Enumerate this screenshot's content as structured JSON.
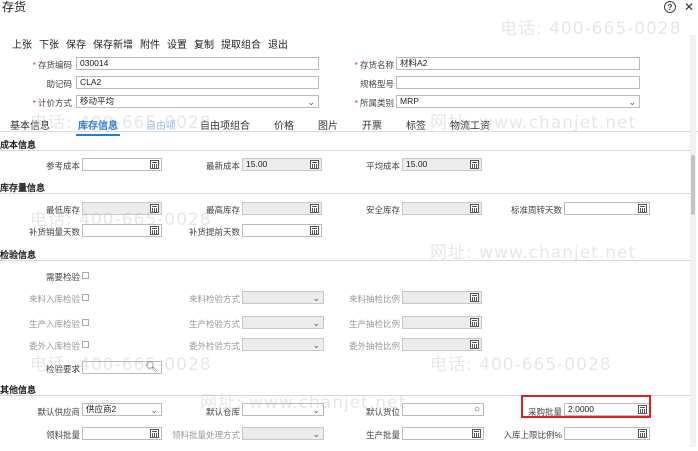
{
  "window": {
    "title": "存货"
  },
  "toolbar": [
    "上张",
    "下张",
    "保存",
    "保存新增",
    "附件",
    "设置",
    "复制",
    "提取组合",
    "退出"
  ],
  "header_fields": {
    "code_label": "存货编码",
    "code_value": "030014",
    "name_label": "存货名称",
    "name_value": "材料A2",
    "mnemonic_label": "助记码",
    "mnemonic_value": "CLA2",
    "spec_label": "规格型号",
    "spec_value": "",
    "pricing_label": "计价方式",
    "pricing_value": "移动平均",
    "category_label": "所属类别",
    "category_value": "MRP"
  },
  "tabs": [
    "基本信息",
    "库存信息",
    "自由项",
    "自由项组合",
    "价格",
    "图片",
    "开票",
    "标签",
    "物流工资"
  ],
  "active_tab": "库存信息",
  "cost_section": {
    "title": "成本信息",
    "ref_cost_label": "参考成本",
    "ref_cost_value": "",
    "latest_cost_label": "最新成本",
    "latest_cost_value": "15.00",
    "avg_cost_label": "平均成本",
    "avg_cost_value": "15.00"
  },
  "stock_section": {
    "title": "库存量信息",
    "min_stock_label": "最低库存",
    "max_stock_label": "最高库存",
    "safety_stock_label": "安全库存",
    "turnover_days_label": "标准周转天数",
    "replenish_qty_label": "补货销量天数",
    "replenish_lead_label": "补货提前天数"
  },
  "inspection_section": {
    "title": "检验信息",
    "need_inspect_label": "需要检验",
    "incoming_inspect_label": "来料入库检验",
    "incoming_method_label": "来料检验方式",
    "incoming_ratio_label": "来料抽检比例",
    "production_inspect_label": "生产入库检验",
    "production_method_label": "生产检验方式",
    "production_ratio_label": "生产抽检比例",
    "outsource_inspect_label": "委外入库检验",
    "outsource_method_label": "委外检验方式",
    "outsource_ratio_label": "委外抽检比例",
    "requirement_label": "检验要求"
  },
  "other_section": {
    "title": "其他信息",
    "default_supplier_label": "默认供应商",
    "default_supplier_value": "供应商2",
    "default_warehouse_label": "默认仓库",
    "default_warehouse_value": "",
    "default_location_label": "默认货位",
    "default_location_value": "",
    "purchase_batch_label": "采购批量",
    "purchase_batch_value": "2.0000",
    "picking_batch_label": "领料批量",
    "picking_method_label": "领料批量处理方式",
    "production_batch_label": "生产批量",
    "inbound_limit_label": "入库上限比例%"
  },
  "watermark": {
    "phone": "电话: 400-665-0028",
    "site": "网址: www.chanjet.net"
  }
}
